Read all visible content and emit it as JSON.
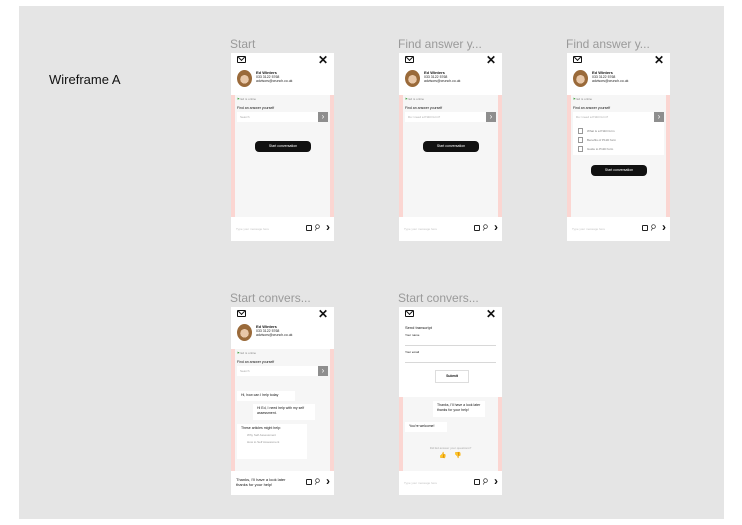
{
  "page": {
    "label": "Wireframe A"
  },
  "contact": {
    "name": "Ed Winters",
    "phone": "033 3122 5768",
    "email": "advisors@crunch.co.uk",
    "status": "Ed is online"
  },
  "search": {
    "label": "Find an answer yourself",
    "placeholder": "Search",
    "typed": "Do I need a P11D form?"
  },
  "composer": {
    "placeholder": "Type your message here"
  },
  "buttons": {
    "start": "Start conversation",
    "submit": "Submit"
  },
  "frames": [
    {
      "title": "Start"
    },
    {
      "title": "Find answer y..."
    },
    {
      "title": "Find answer y..."
    },
    {
      "title": "Start convers..."
    },
    {
      "title": "Start convers..."
    }
  ],
  "suggestions": [
    "What is a P11D form",
    "Benefits of P11D form",
    "Guide to P11D form"
  ],
  "chat": {
    "agent_greeting": "Hi, how can I help today",
    "user_question": "Hi Ed, I need help with my self assessment.",
    "articles_intro": "These articles might help:",
    "articles": [
      "Why Self Assessment",
      "How to Self Assessment"
    ],
    "user_thanks": "Thanks, I'll have a look later thanks for your help!",
    "agent_welcome": "You're welcome!"
  },
  "transcript": {
    "title": "Send transcript",
    "name_label": "Your name",
    "email_label": "Your email",
    "feedback": "Did Ed answer your questions?"
  },
  "colors": {
    "canvas": "#e5e5e5",
    "gutter": "#fbd6d2",
    "frame": "#f6f6f6",
    "dark_button": "#111111"
  }
}
